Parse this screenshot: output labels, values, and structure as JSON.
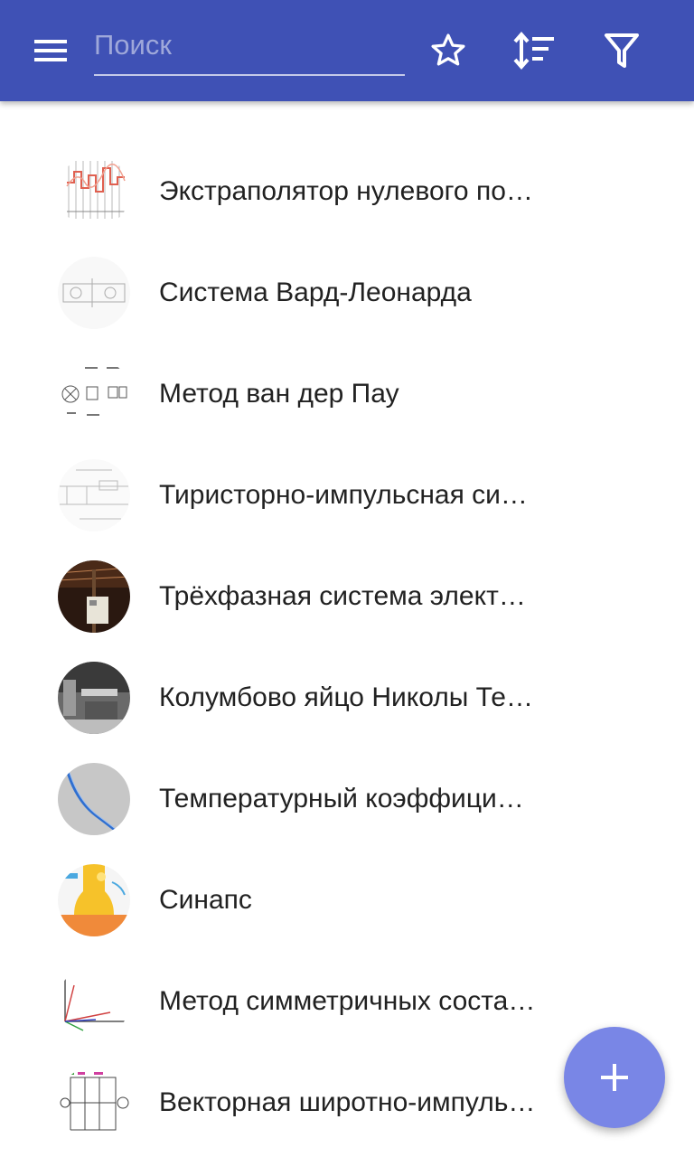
{
  "appbar": {
    "search_placeholder": "Поиск",
    "menu_icon": "menu-icon",
    "favorites_icon": "star-outline-icon",
    "sort_icon": "sort-icon",
    "filter_icon": "filter-icon",
    "background_color": "#3f51b5"
  },
  "items": [
    {
      "label": "Экстраполятор нулевого порядка",
      "thumb": "thumb-step-chart"
    },
    {
      "label": "Система Вард-Леонарда",
      "thumb": "thumb-circuit-diagram"
    },
    {
      "label": "Метод ван дер Пау",
      "thumb": "thumb-sample-geometries"
    },
    {
      "label": "Тиристорно-импульсная система",
      "thumb": "thumb-schematic"
    },
    {
      "label": "Трёхфазная система электроснабжения",
      "thumb": "thumb-power-pole-photo"
    },
    {
      "label": "Колумбово яйцо Николы Теслы",
      "thumb": "thumb-bw-photo"
    },
    {
      "label": "Температурный коэффициент",
      "thumb": "thumb-wire-photo"
    },
    {
      "label": "Синапс",
      "thumb": "thumb-synapse-illustration"
    },
    {
      "label": "Метод симметричных составляющих",
      "thumb": "thumb-vector-diagram"
    },
    {
      "label": "Векторная широтно-импульсная модуляция",
      "thumb": "thumb-inverter-circuit"
    }
  ],
  "fab": {
    "icon": "plus-icon",
    "color": "#7986e6"
  }
}
